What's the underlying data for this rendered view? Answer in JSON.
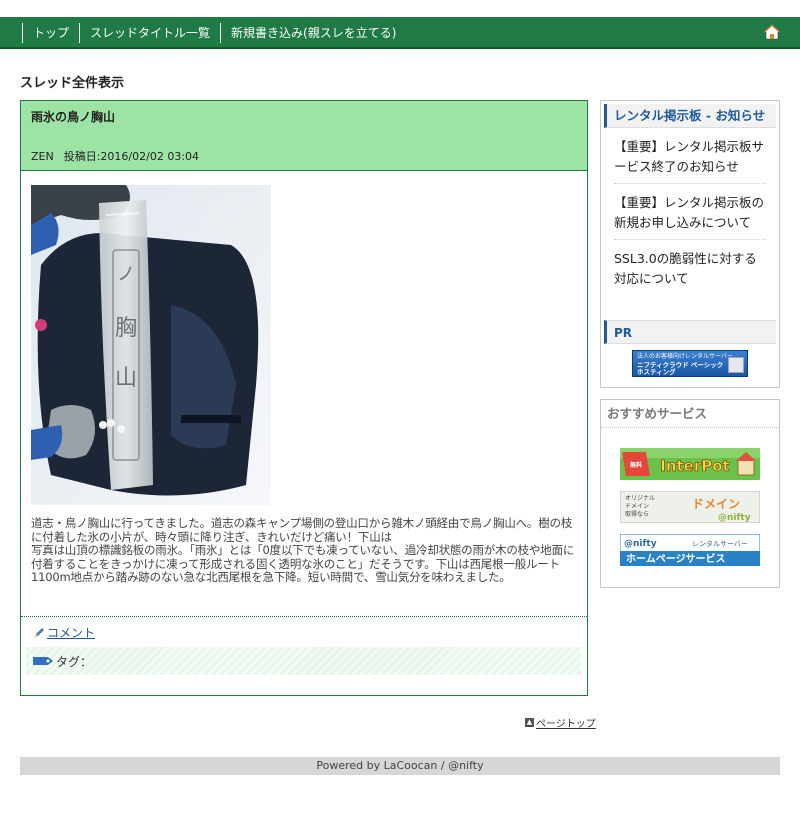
{
  "nav": {
    "items": [
      "トップ",
      "スレッドタイトル一覧",
      "新規書き込み(親スレを立てる)"
    ],
    "home_icon": "home-icon"
  },
  "section_title": "スレッド全件表示",
  "thread": {
    "title": "雨氷の鳥ノ胸山",
    "author": "ZEN",
    "posted": "投稿日:2016/02/02 03:04",
    "body": "道志・鳥ノ胸山に行ってきました。道志の森キャンプ場側の登山口から雑木ノ頭経由で鳥ノ胸山へ。樹の枝に付着した氷の小片が、時々頭に降り注ぎ、きれいだけど痛い！下山は\n写真は山頂の標識銘板の雨氷。「雨氷」とは「0度以下でも凍っていない、過冷却状態の雨が木の枝や地面に付着することをきっかけに凍って形成される固く透明な氷のこと」だそうです。下山は西尾根一般ルート1100m地点から踏み跡のない急な北西尾根を急下降。短い時間で、雪山気分を味わえました。",
    "photo_sign_text": "鳥ノ胸山",
    "comment_label": "コメント",
    "tag_label": "タグ：",
    "accent": "#1f7a45",
    "head_bg": "#9de3a6"
  },
  "page_top": "ページトップ",
  "footer": "Powered by LaCoocan / @nifty",
  "sidebar": {
    "notice_title": "レンタル掲示板 - お知らせ",
    "notices": [
      "【重要】レンタル掲示板サービス終了のお知らせ",
      "【重要】レンタル掲示板の新規お申し込みについて",
      "SSL3.0の脆弱性に対する対応について"
    ],
    "pr_title": "PR",
    "pr_banner_top": "法人のお客様向けレンタルサーバー",
    "pr_banner_main": "ニフティクラウド ベーシックホスティング",
    "services_title": "おすすめサービス",
    "services": [
      {
        "name": "InterPot",
        "icon": "interpot-banner"
      },
      {
        "name": "オリジナルドメイン取得なら ドメイン @nifty",
        "icon": "domain-banner"
      },
      {
        "name": "@nifty レンタルサーバー ホームページサービス",
        "icon": "homepage-service-banner"
      }
    ]
  }
}
